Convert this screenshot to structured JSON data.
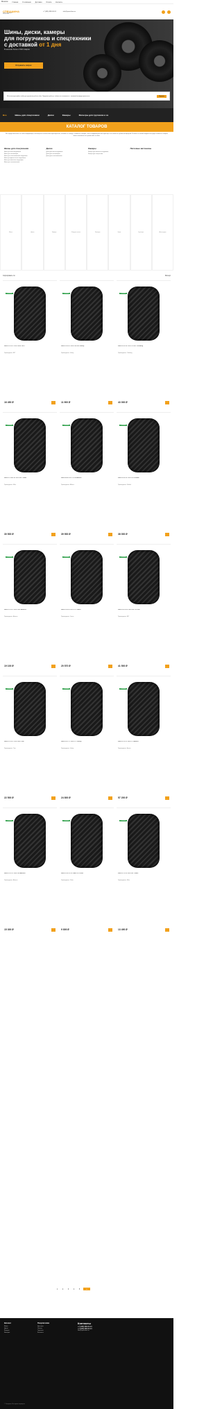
{
  "topbar": {
    "city": "Moscow",
    "menu": [
      "Главная",
      "О компании",
      "Доставка",
      "Оплата",
      "Контакты"
    ]
  },
  "header": {
    "brand": "СПЕЦШИНА",
    "sub": "шины и диски для спецтехники",
    "phone": "+7 (495) 989-03-24",
    "email": "info@specshina.ru"
  },
  "hero": {
    "title_1": "Шины, диски, камеры",
    "title_2": "для погрузчиков и спецтехники",
    "title_3_prefix": "с доставкой ",
    "title_3_accent": "от 1 дня",
    "note": "В наличии более 2 500 товаров",
    "cta": "Отправить запрос",
    "cookie_text": "Мы используем файлы cookie для улучшения работы сайта. Продолжая работу с сайтом, вы соглашаетесь с политикой конфиденциальности.",
    "cookie_ok": "Хорошо"
  },
  "nav": {
    "items": [
      {
        "label": "Все"
      },
      {
        "label": "Шины для спецтехники"
      },
      {
        "label": "Диски"
      },
      {
        "label": "Камеры"
      },
      {
        "label": "Фильтры для грузчиков и се"
      }
    ]
  },
  "catalog": {
    "title": "КАТАЛОГ ТОВАРОВ",
    "intro": "Вся представленная на сайте информация, касающаяся технических характеристик, наличия на складе, стоимости товаров, носит информационный характер и не является публичной офертой. В связи со сменой модельного ряда стоимость товаров может отличаться от указанной на сайте."
  },
  "categories": [
    {
      "title": "Шины для спецтехники",
      "links": [
        "Шины для мини-погрузчиков",
        "Шины для экскаваторов",
        "Шины для телескопических погрузчиков",
        "Шины для фронтальных погрузчиков",
        "Шины для вилочных погрузчиков",
        "Шины для сельхозтехники"
      ]
    },
    {
      "title": "Диски",
      "links": [
        "Диски для мини-погрузчиков",
        "Диски для экскаваторов",
        "Диски для телескопических"
      ]
    },
    {
      "title": "Камеры",
      "links": [
        "Камеры для вилочных погрузчиков",
        "Камеры для спецтехники"
      ]
    },
    {
      "title": "Легковые автошины",
      "links": []
    }
  ],
  "tiles": [
    "Шины",
    "Диски",
    "Камеры",
    "Ободные ленты",
    "Фильтры",
    "Цепи",
    "Гусеницы",
    "Аксессуары"
  ],
  "sort": {
    "label": "Сортировать по",
    "view": "Фильтр"
  },
  "products": [
    {
      "name": "Шина 12-16.5 12PR SKS-1 BKT",
      "spec": "Производитель: BKT",
      "price": "16 450 ₽",
      "badge": "В наличии"
    },
    {
      "name": "Шина 10-16.5 10PR SK-900 Galaxy",
      "spec": "Производитель: Galaxy",
      "price": "11 900 ₽",
      "badge": "В наличии"
    },
    {
      "name": "Шина 16.9-28 12PR TR-459 Trelleborg",
      "spec": "Производитель: Trelleborg",
      "price": "43 000 ₽",
      "badge": "В наличии"
    },
    {
      "name": "Шина 12.5/80-18 14PR MPT Mitas",
      "spec": "Производитель: Mitas",
      "price": "30 500 ₽",
      "badge": "В наличии"
    },
    {
      "name": "Шина 400/70-20 IT-510 Alliance",
      "spec": "Производитель: Alliance",
      "price": "39 900 ₽",
      "badge": "В наличии"
    },
    {
      "name": "Шина 18.4-26 12PR R-4 Solideal",
      "spec": "Производитель: Solideal",
      "price": "38 000 ₽",
      "badge": "В наличии"
    },
    {
      "name": "Шина 12-16.5 10PR SKZ Advance",
      "spec": "Производитель: Advance",
      "price": "19 100 ₽",
      "badge": "В наличии"
    },
    {
      "name": "Шина 10-16.5 8PR L-5 Camso",
      "spec": "Производитель: Camso",
      "price": "20 570 ₽",
      "badge": "В наличии"
    },
    {
      "name": "Шина 16/70-20 14PR MPT-01 BKT",
      "spec": "Производитель: BKT",
      "price": "41 500 ₽",
      "badge": "В наличии"
    },
    {
      "name": "Шина 12-16.5 12PR SKS Titan",
      "spec": "Производитель: Titan",
      "price": "22 500 ₽",
      "badge": "В наличии"
    },
    {
      "name": "Шина 14-17.5 14PR L-2 Galaxy",
      "spec": "Производитель: Galaxy",
      "price": "24 800 ₽",
      "badge": "В наличии"
    },
    {
      "name": "Шина 23.5-25 16PR L-3 Armour",
      "spec": "Производитель: Armour",
      "price": "57 200 ₽",
      "badge": "В наличии"
    },
    {
      "name": "Шина 15-19.5 14PR SK Advance",
      "spec": "Производитель: Advance",
      "price": "15 300 ₽",
      "badge": "В наличии"
    },
    {
      "name": "Шина 10.0/75-15.3 AW-702 Petlas",
      "spec": "Производитель: Petlas",
      "price": "9 800 ₽",
      "badge": "В наличии"
    },
    {
      "name": "Шина 12.5-20 10PR MPT Mitas",
      "spec": "Производитель: Mitas",
      "price": "13 490 ₽",
      "badge": "В наличии"
    }
  ],
  "pager": [
    "1",
    "2",
    "3",
    "4",
    "5",
    "»"
  ],
  "footer": {
    "col1": {
      "title": "Каталог",
      "links": [
        "Шины",
        "Диски",
        "Камеры",
        "Фильтры"
      ]
    },
    "col2": {
      "title": "Покупателям",
      "links": [
        "Доставка",
        "Оплата",
        "Гарантия",
        "Контакты"
      ]
    },
    "contacts": {
      "title": "Контакты",
      "phones": [
        "+7 (495) 989-03-24",
        "+7 (926) 989-03-24"
      ],
      "email": "info@specshina.ru"
    },
    "copy": "© Спецшина. Все права защищены."
  },
  "colors": {
    "accent": "#f2a11c",
    "dark": "#222222",
    "badge": "#2fa04a"
  }
}
